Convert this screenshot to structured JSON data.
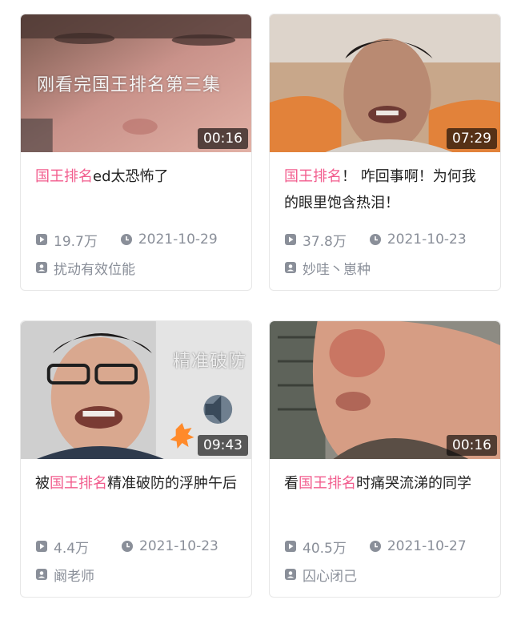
{
  "videos": [
    {
      "thumb_caption": "刚看完国王排名第三集",
      "duration": "00:16",
      "title_prefix": "",
      "title_highlight": "国王排名",
      "title_rest": "ed太恐怖了",
      "views": "19.7万",
      "date": "2021-10-29",
      "author": "扰动有效位能"
    },
    {
      "thumb_caption": "",
      "duration": "07:29",
      "title_prefix": "",
      "title_highlight": "国王排名",
      "title_rest": "！ 咋回事啊！为何我的眼里饱含热泪！",
      "views": "37.8万",
      "date": "2021-10-23",
      "author": "妙哇丶崽种"
    },
    {
      "thumb_caption": "精准破防",
      "duration": "09:43",
      "title_prefix": "被",
      "title_highlight": "国王排名",
      "title_rest": "精准破防的浮肿午后",
      "views": "4.4万",
      "date": "2021-10-23",
      "author": "阚老师"
    },
    {
      "thumb_caption": "",
      "duration": "00:16",
      "title_prefix": "看",
      "title_highlight": "国王排名",
      "title_rest": "时痛哭流涕的同学",
      "views": "40.5万",
      "date": "2021-10-27",
      "author": "囚心闭己"
    }
  ],
  "icons": {
    "views": "play-icon",
    "date": "clock-icon",
    "author": "uploader-icon"
  },
  "colors": {
    "highlight": "#f25d8e",
    "meta": "#8a8f99",
    "title": "#222222"
  }
}
